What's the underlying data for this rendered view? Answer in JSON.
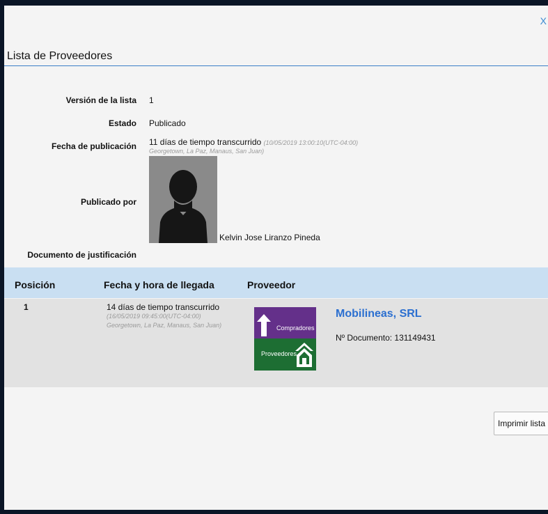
{
  "dialog": {
    "close_label": "X",
    "title": "Lista de Proveedores"
  },
  "details": {
    "version": {
      "label": "Versión de la lista",
      "value": "1"
    },
    "status": {
      "label": "Estado",
      "value": "Publicado"
    },
    "publication_date": {
      "label": "Fecha de publicación",
      "value": "11 días de tiempo transcurrido",
      "timestamp": "(10/05/2019 13:00:10(UTC-04:00)",
      "timezone": "Georgetown, La Paz, Manaus, San Juan)"
    },
    "published_by": {
      "label": "Publicado por",
      "name": "Kelvin Jose Liranzo Pineda"
    },
    "justification_document": {
      "label": "Documento de justificación"
    }
  },
  "grid": {
    "columns": [
      "Posición",
      "Fecha y hora de llegada",
      "Proveedor"
    ],
    "rows": [
      {
        "position": "1",
        "elapsed": "14 días de tiempo transcurrido",
        "timestamp": "(16/05/2019 09:45:00(UTC-04:00)",
        "timezone": "Georgetown, La Paz, Manaus, San Juan)",
        "logo_top_text": "Compradores",
        "logo_bottom_text": "Proveedores",
        "supplier_name": "Mobilineas, SRL",
        "document": "Nº Documento: 131149431"
      }
    ]
  },
  "actions": {
    "print_label": "Imprimir lista"
  },
  "colors": {
    "header_band": "#c9dff2",
    "row_band": "#e2e2e2",
    "link_blue": "#2b6fd0",
    "logo_purple": "#64308a",
    "logo_green": "#1d6e33"
  }
}
